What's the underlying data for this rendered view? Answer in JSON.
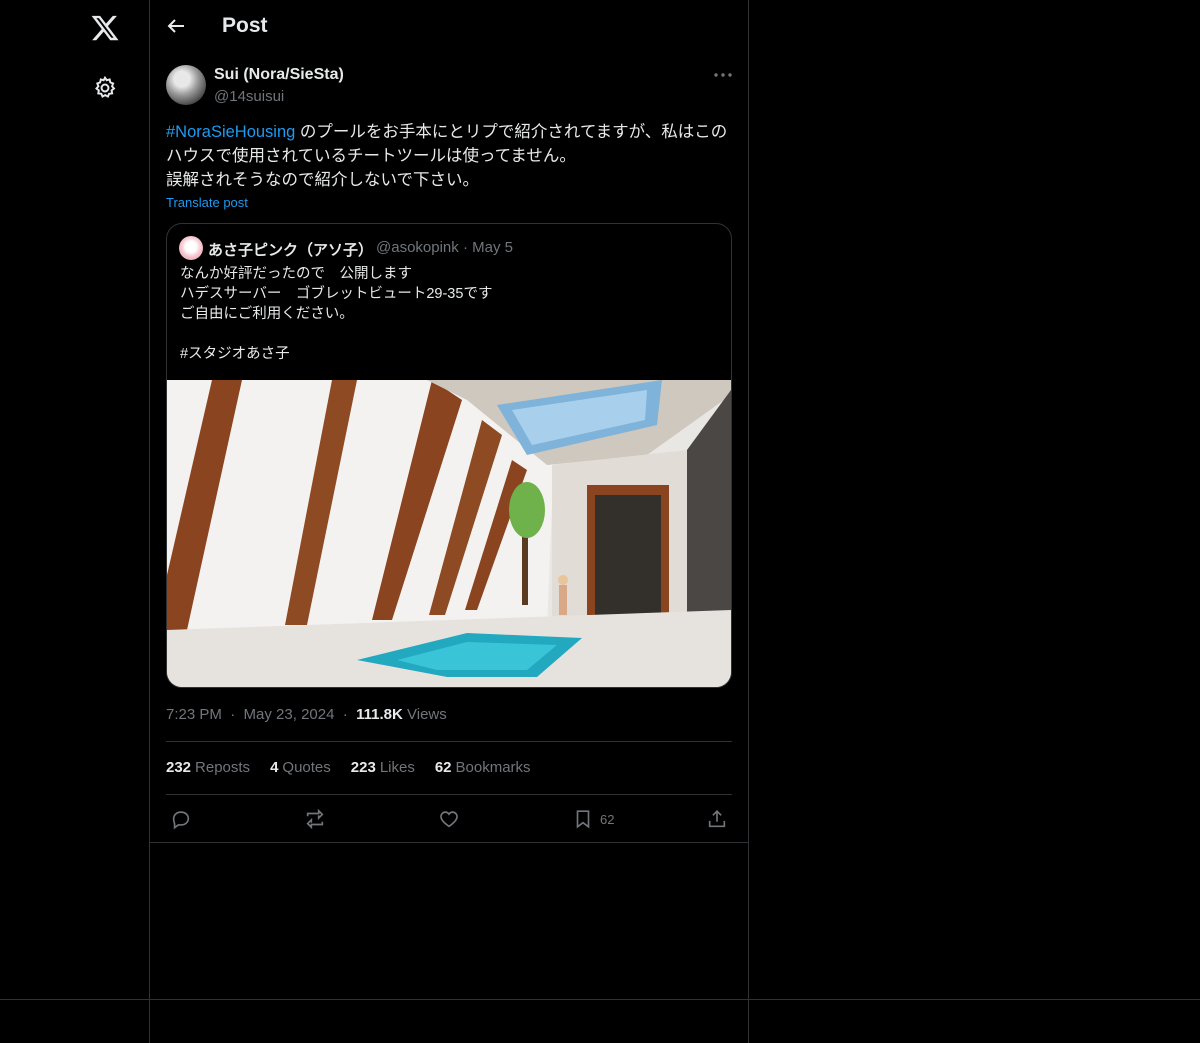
{
  "header": {
    "title": "Post"
  },
  "post": {
    "author_name": "Sui (Nora/SieSta)",
    "author_handle": "@14suisui",
    "hashtag": "#NoraSieHousing",
    "text_rest": " のプールをお手本にとリプで紹介されてますが、私はこのハウスで使用されているチートツールは使ってません。",
    "text_line2": "誤解されそうなので紹介しないで下さい。",
    "translate_label": "Translate post",
    "time": "7:23 PM",
    "date": "May 23, 2024",
    "views_count": "111.8K",
    "views_label": "Views"
  },
  "quote": {
    "name": "あさ子ピンク（アソ子）",
    "handle": "@asokopink",
    "date": "May 5",
    "text": "なんか好評だったので　公開します\nハデスサーバー　ゴブレットビュート29-35です\nご自由にご利用ください。\n\n#スタジオあさ子"
  },
  "stats": [
    {
      "count": "232",
      "label": "Reposts"
    },
    {
      "count": "4",
      "label": "Quotes"
    },
    {
      "count": "223",
      "label": "Likes"
    },
    {
      "count": "62",
      "label": "Bookmarks"
    }
  ],
  "actions": {
    "bookmark_count": "62"
  },
  "icons": {
    "logo": "x-logo-icon",
    "settings": "gear-icon",
    "back": "back-arrow-icon",
    "more": "more-dots-icon",
    "reply": "reply-icon",
    "repost": "repost-icon",
    "like": "heart-icon",
    "bookmark": "bookmark-icon",
    "share": "share-icon"
  },
  "colors": {
    "background": "#000000",
    "accent": "#1d9bf0",
    "muted": "#71767b",
    "border": "#2f3336"
  }
}
